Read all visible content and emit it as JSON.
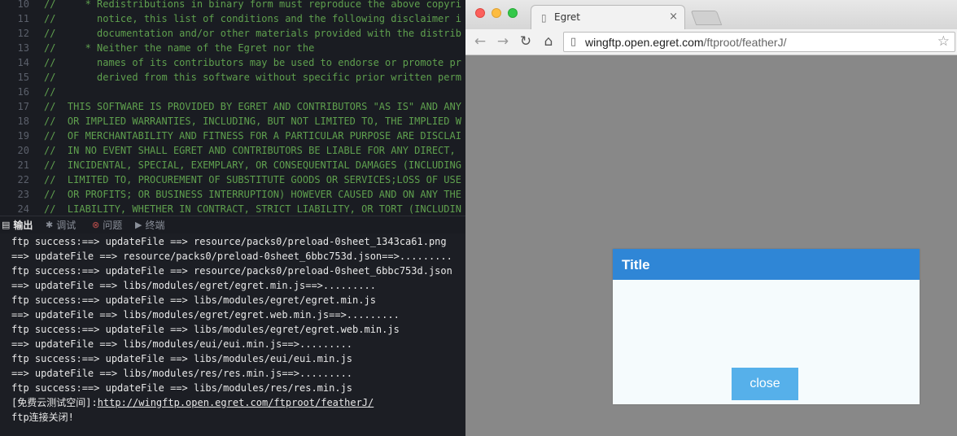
{
  "editor": {
    "lines": [
      {
        "num": "10",
        "text": "//     * Redistributions in binary form must reproduce the above copyri"
      },
      {
        "num": "11",
        "text": "//       notice, this list of conditions and the following disclaimer i"
      },
      {
        "num": "12",
        "text": "//       documentation and/or other materials provided with the distrib"
      },
      {
        "num": "13",
        "text": "//     * Neither the name of the Egret nor the"
      },
      {
        "num": "14",
        "text": "//       names of its contributors may be used to endorse or promote pr"
      },
      {
        "num": "15",
        "text": "//       derived from this software without specific prior written perm"
      },
      {
        "num": "16",
        "text": "//"
      },
      {
        "num": "17",
        "text": "//  THIS SOFTWARE IS PROVIDED BY EGRET AND CONTRIBUTORS \"AS IS\" AND ANY"
      },
      {
        "num": "18",
        "text": "//  OR IMPLIED WARRANTIES, INCLUDING, BUT NOT LIMITED TO, THE IMPLIED W"
      },
      {
        "num": "19",
        "text": "//  OF MERCHANTABILITY AND FITNESS FOR A PARTICULAR PURPOSE ARE DISCLAI"
      },
      {
        "num": "20",
        "text": "//  IN NO EVENT SHALL EGRET AND CONTRIBUTORS BE LIABLE FOR ANY DIRECT,"
      },
      {
        "num": "21",
        "text": "//  INCIDENTAL, SPECIAL, EXEMPLARY, OR CONSEQUENTIAL DAMAGES (INCLUDING"
      },
      {
        "num": "22",
        "text": "//  LIMITED TO, PROCUREMENT OF SUBSTITUTE GOODS OR SERVICES;LOSS OF USE"
      },
      {
        "num": "23",
        "text": "//  OR PROFITS; OR BUSINESS INTERRUPTION) HOWEVER CAUSED AND ON ANY THE"
      },
      {
        "num": "24",
        "text": "//  LIABILITY, WHETHER IN CONTRACT, STRICT LIABILITY, OR TORT (INCLUDIN"
      }
    ]
  },
  "panel": {
    "tabs": [
      {
        "icon": "▤",
        "label": "输出"
      },
      {
        "icon": "✱",
        "label": "调试"
      },
      {
        "icon": "⊗",
        "label": "问题"
      },
      {
        "icon": "▶",
        "label": "终端"
      }
    ]
  },
  "terminal": {
    "lines": [
      "ftp success:==> updateFile ==> resource/packs0/preload-0sheet_1343ca61.png",
      "==> updateFile ==> resource/packs0/preload-0sheet_6bbc753d.json==>.........",
      "ftp success:==> updateFile ==> resource/packs0/preload-0sheet_6bbc753d.json",
      "==> updateFile ==> libs/modules/egret/egret.min.js==>.........",
      "ftp success:==> updateFile ==> libs/modules/egret/egret.min.js",
      "==> updateFile ==> libs/modules/egret/egret.web.min.js==>.........",
      "ftp success:==> updateFile ==> libs/modules/egret/egret.web.min.js",
      "==> updateFile ==> libs/modules/eui/eui.min.js==>.........",
      "ftp success:==> updateFile ==> libs/modules/eui/eui.min.js",
      "==> updateFile ==> libs/modules/res/res.min.js==>.........",
      "ftp success:==> updateFile ==> libs/modules/res/res.min.js"
    ],
    "space_prefix": "[免费云测试空间]:",
    "space_link": "http://wingftp.open.egret.com/ftproot/featherJ/",
    "closed": "ftp连接关闭!"
  },
  "browser": {
    "tab_title": "Egret",
    "tab_close": "×",
    "url_host": "wingftp.open.egret.com",
    "url_path": "/ftproot/featherJ/",
    "dialog_title": "Title",
    "dialog_close": "close"
  }
}
